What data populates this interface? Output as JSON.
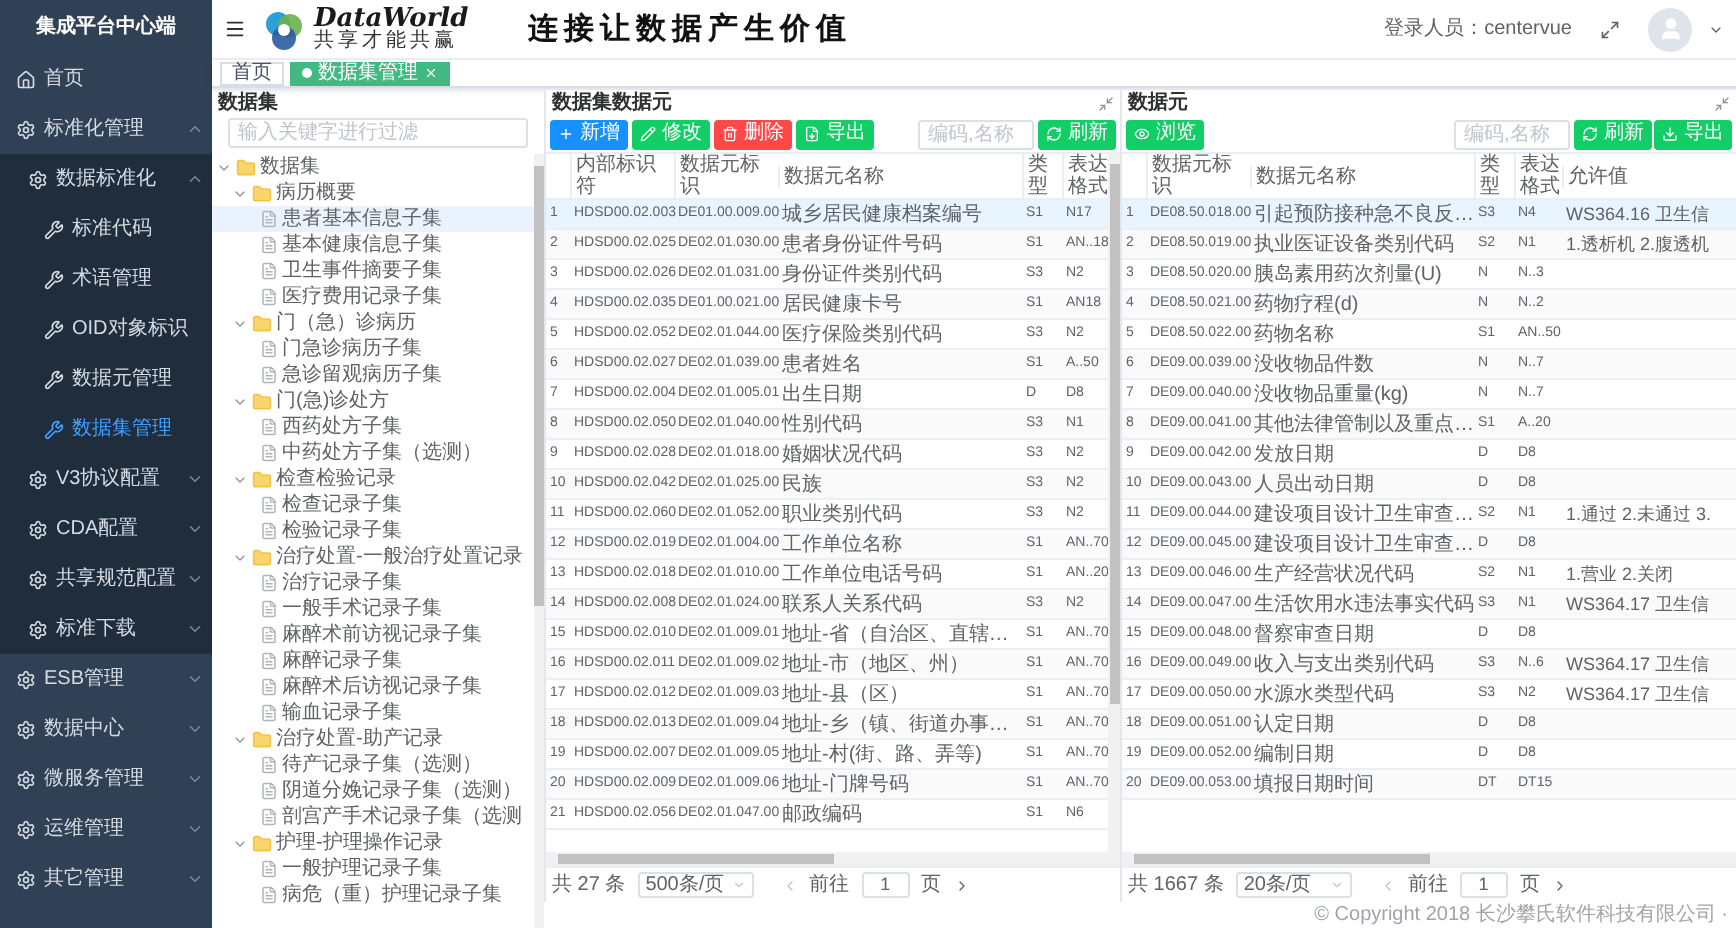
{
  "sidebar": {
    "title": "集成平台中心端",
    "items": [
      {
        "label": "首页",
        "kind": "home"
      },
      {
        "label": "标准化管理",
        "kind": "group",
        "expanded": true,
        "children": [
          {
            "label": "数据标准化",
            "kind": "group",
            "expanded": true,
            "children": [
              {
                "label": "标准代码",
                "kind": "page",
                "selected": false
              },
              {
                "label": "术语管理",
                "kind": "page",
                "selected": false
              },
              {
                "label": "OID对象标识",
                "kind": "page",
                "selected": false
              },
              {
                "label": "数据元管理",
                "kind": "page",
                "selected": false
              },
              {
                "label": "数据集管理",
                "kind": "page",
                "selected": true
              }
            ]
          },
          {
            "label": "V3协议配置",
            "kind": "group",
            "expanded": false
          },
          {
            "label": "CDA配置",
            "kind": "group",
            "expanded": false
          },
          {
            "label": "共享规范配置",
            "kind": "group",
            "expanded": false
          },
          {
            "label": "标准下载",
            "kind": "group",
            "expanded": false
          }
        ]
      },
      {
        "label": "ESB管理",
        "kind": "group",
        "expanded": false
      },
      {
        "label": "数据中心",
        "kind": "group",
        "expanded": false
      },
      {
        "label": "微服务管理",
        "kind": "group",
        "expanded": false
      },
      {
        "label": "运维管理",
        "kind": "group",
        "expanded": false
      },
      {
        "label": "其它管理",
        "kind": "group",
        "expanded": false
      }
    ]
  },
  "header": {
    "logo_name": "DataWorld",
    "logo_tagline": "共享才能共赢",
    "slogan": "连接让数据产生价值",
    "user_label": "登录人员：centervue"
  },
  "tabs": [
    {
      "label": "首页",
      "selected": false
    },
    {
      "label": "数据集管理",
      "selected": true
    }
  ],
  "tree_panel": {
    "title": "数据集",
    "placeholder": "输入关键字进行过滤",
    "nodes": [
      {
        "label": "数据集",
        "expanded": true,
        "children": [
          {
            "label": "病历概要",
            "expanded": true,
            "children": [
              {
                "label": "患者基本信息子集",
                "selected": true
              },
              {
                "label": "基本健康信息子集",
                "selected": false
              },
              {
                "label": "卫生事件摘要子集",
                "selected": false
              },
              {
                "label": "医疗费用记录子集",
                "selected": false
              }
            ]
          },
          {
            "label": "门（急）诊病历",
            "expanded": true,
            "children": [
              {
                "label": "门急诊病历子集",
                "selected": false
              },
              {
                "label": "急诊留观病历子集",
                "selected": false
              }
            ]
          },
          {
            "label": "门(急)诊处方",
            "expanded": true,
            "children": [
              {
                "label": "西药处方子集",
                "selected": false
              },
              {
                "label": "中药处方子集（选测）",
                "selected": false
              }
            ]
          },
          {
            "label": "检查检验记录",
            "expanded": true,
            "children": [
              {
                "label": "检查记录子集",
                "selected": false
              },
              {
                "label": "检验记录子集",
                "selected": false
              }
            ]
          },
          {
            "label": "治疗处置-一般治疗处置记录",
            "expanded": true,
            "children": [
              {
                "label": "治疗记录子集",
                "selected": false
              },
              {
                "label": "一般手术记录子集",
                "selected": false
              },
              {
                "label": "麻醉术前访视记录子集",
                "selected": false
              },
              {
                "label": "麻醉记录子集",
                "selected": false
              },
              {
                "label": "麻醉术后访视记录子集",
                "selected": false
              },
              {
                "label": "输血记录子集",
                "selected": false
              }
            ]
          },
          {
            "label": "治疗处置-助产记录",
            "expanded": true,
            "children": [
              {
                "label": "待产记录子集（选测）",
                "selected": false
              },
              {
                "label": "阴道分娩记录子集（选测）",
                "selected": false
              },
              {
                "label": "剖宫产手术记录子集（选测",
                "selected": false
              }
            ]
          },
          {
            "label": "护理-护理操作记录",
            "expanded": true,
            "children": [
              {
                "label": "一般护理记录子集",
                "selected": false
              },
              {
                "label": "病危（重）护理记录子集",
                "selected": false
              }
            ]
          }
        ]
      }
    ]
  },
  "middle_panel": {
    "title": "数据集数据元",
    "buttons": [
      {
        "label": "新增",
        "kind": "add"
      },
      {
        "label": "修改",
        "kind": "edit"
      },
      {
        "label": "删除",
        "kind": "delete"
      },
      {
        "label": "导出",
        "kind": "export"
      }
    ],
    "placeholder": "编码,名称",
    "right_buttons": [
      {
        "label": "刷新",
        "kind": "refresh"
      }
    ],
    "columns": [
      "",
      "内部标识符",
      "数据元标识",
      "数据元名称",
      "类型",
      "表达格式"
    ],
    "rows": [
      {
        "selected": true,
        "cells": [
          "1",
          "HDSD00.02.003",
          "DE01.00.009.00",
          "城乡居民健康档案编号",
          "S1",
          "N17"
        ]
      },
      {
        "selected": false,
        "cells": [
          "2",
          "HDSD00.02.025",
          "DE02.01.030.00",
          "患者身份证件号码",
          "S1",
          "AN..18"
        ]
      },
      {
        "selected": false,
        "cells": [
          "3",
          "HDSD00.02.026",
          "DE02.01.031.00",
          "身份证件类别代码",
          "S3",
          "N2"
        ]
      },
      {
        "selected": false,
        "cells": [
          "4",
          "HDSD00.02.035",
          "DE01.00.021.00",
          "居民健康卡号",
          "S1",
          "AN18"
        ]
      },
      {
        "selected": false,
        "cells": [
          "5",
          "HDSD00.02.052",
          "DE02.01.044.00",
          "医疗保险类别代码",
          "S3",
          "N2"
        ]
      },
      {
        "selected": false,
        "cells": [
          "6",
          "HDSD00.02.027",
          "DE02.01.039.00",
          "患者姓名",
          "S1",
          "A..50"
        ]
      },
      {
        "selected": false,
        "cells": [
          "7",
          "HDSD00.02.004",
          "DE02.01.005.01",
          "出生日期",
          "D",
          "D8"
        ]
      },
      {
        "selected": false,
        "cells": [
          "8",
          "HDSD00.02.050",
          "DE02.01.040.00",
          "性别代码",
          "S3",
          "N1"
        ]
      },
      {
        "selected": false,
        "cells": [
          "9",
          "HDSD00.02.028",
          "DE02.01.018.00",
          "婚姻状况代码",
          "S3",
          "N2"
        ]
      },
      {
        "selected": false,
        "cells": [
          "10",
          "HDSD00.02.042",
          "DE02.01.025.00",
          "民族",
          "S3",
          "N2"
        ]
      },
      {
        "selected": false,
        "cells": [
          "11",
          "HDSD00.02.060",
          "DE02.01.052.00",
          "职业类别代码",
          "S3",
          "N2"
        ]
      },
      {
        "selected": false,
        "cells": [
          "12",
          "HDSD00.02.019",
          "DE02.01.004.00",
          "工作单位名称",
          "S1",
          "AN..70"
        ]
      },
      {
        "selected": false,
        "cells": [
          "13",
          "HDSD00.02.018",
          "DE02.01.010.00",
          "工作单位电话号码",
          "S1",
          "AN..20"
        ]
      },
      {
        "selected": false,
        "cells": [
          "14",
          "HDSD00.02.008",
          "DE02.01.024.00",
          "联系人关系代码",
          "S3",
          "N2"
        ]
      },
      {
        "selected": false,
        "cells": [
          "15",
          "HDSD00.02.010",
          "DE02.01.009.01",
          "地址-省（自治区、直辖…",
          "S1",
          "AN..70"
        ]
      },
      {
        "selected": false,
        "cells": [
          "16",
          "HDSD00.02.011",
          "DE02.01.009.02",
          "地址-市（地区、州）",
          "S1",
          "AN..70"
        ]
      },
      {
        "selected": false,
        "cells": [
          "17",
          "HDSD00.02.012",
          "DE02.01.009.03",
          "地址-县（区）",
          "S1",
          "AN..70"
        ]
      },
      {
        "selected": false,
        "cells": [
          "18",
          "HDSD00.02.013",
          "DE02.01.009.04",
          "地址-乡（镇、街道办事…",
          "S1",
          "AN..70"
        ]
      },
      {
        "selected": false,
        "cells": [
          "19",
          "HDSD00.02.007",
          "DE02.01.009.05",
          "地址-村(街、路、弄等)",
          "S1",
          "AN..70"
        ]
      },
      {
        "selected": false,
        "cells": [
          "20",
          "HDSD00.02.009",
          "DE02.01.009.06",
          "地址-门牌号码",
          "S1",
          "AN..70"
        ]
      },
      {
        "selected": false,
        "cells": [
          "21",
          "HDSD00.02.056",
          "DE02.01.047.00",
          "邮政编码",
          "S1",
          "N6"
        ]
      }
    ],
    "footer": {
      "total": "共 27 条",
      "page_size": "500条/页",
      "goto": "前往",
      "page": "1",
      "page_unit": "页"
    }
  },
  "right_panel": {
    "title": "数据元",
    "buttons": [
      {
        "label": "浏览",
        "kind": "browse"
      }
    ],
    "placeholder": "编码,名称",
    "right_buttons": [
      {
        "label": "刷新",
        "kind": "refresh"
      },
      {
        "label": "导出",
        "kind": "download"
      }
    ],
    "columns": [
      "",
      "数据元标识",
      "数据元名称",
      "类型",
      "表达格式",
      "允许值"
    ],
    "rows": [
      {
        "selected": true,
        "cells": [
          "1",
          "DE08.50.018.00",
          "引起预防接种急不良反…",
          "S3",
          "N4",
          "WS364.16 卫生信"
        ]
      },
      {
        "selected": false,
        "cells": [
          "2",
          "DE08.50.019.00",
          "执业医证设备类别代码",
          "S2",
          "N1",
          "1.透析机 2.腹透机"
        ]
      },
      {
        "selected": false,
        "cells": [
          "3",
          "DE08.50.020.00",
          "胰岛素用药次剂量(U)",
          "N",
          "N..3",
          ""
        ]
      },
      {
        "selected": false,
        "cells": [
          "4",
          "DE08.50.021.00",
          "药物疗程(d)",
          "N",
          "N..2",
          ""
        ]
      },
      {
        "selected": false,
        "cells": [
          "5",
          "DE08.50.022.00",
          "药物名称",
          "S1",
          "AN..50",
          ""
        ]
      },
      {
        "selected": false,
        "cells": [
          "6",
          "DE09.00.039.00",
          "没收物品件数",
          "N",
          "N..7",
          ""
        ]
      },
      {
        "selected": false,
        "cells": [
          "7",
          "DE09.00.040.00",
          "没收物品重量(kg)",
          "N",
          "N..7",
          ""
        ]
      },
      {
        "selected": false,
        "cells": [
          "8",
          "DE09.00.041.00",
          "其他法律管制以及重点…",
          "S1",
          "A..20",
          ""
        ]
      },
      {
        "selected": false,
        "cells": [
          "9",
          "DE09.00.042.00",
          "发放日期",
          "D",
          "D8",
          ""
        ]
      },
      {
        "selected": false,
        "cells": [
          "10",
          "DE09.00.043.00",
          "人员出动日期",
          "D",
          "D8",
          ""
        ]
      },
      {
        "selected": false,
        "cells": [
          "11",
          "DE09.00.044.00",
          "建设项目设计卫生审查…",
          "S2",
          "N1",
          "1.通过 2.未通过 3."
        ]
      },
      {
        "selected": false,
        "cells": [
          "12",
          "DE09.00.045.00",
          "建设项目设计卫生审查…",
          "D",
          "D8",
          ""
        ]
      },
      {
        "selected": false,
        "cells": [
          "13",
          "DE09.00.046.00",
          "生产经营状况代码",
          "S2",
          "N1",
          "1.营业 2.关闭"
        ]
      },
      {
        "selected": false,
        "cells": [
          "14",
          "DE09.00.047.00",
          "生活饮用水违法事实代码",
          "S3",
          "N1",
          "WS364.17 卫生信"
        ]
      },
      {
        "selected": false,
        "cells": [
          "15",
          "DE09.00.048.00",
          "督察审查日期",
          "D",
          "D8",
          ""
        ]
      },
      {
        "selected": false,
        "cells": [
          "16",
          "DE09.00.049.00",
          "收入与支出类别代码",
          "S3",
          "N..6",
          "WS364.17 卫生信"
        ]
      },
      {
        "selected": false,
        "cells": [
          "17",
          "DE09.00.050.00",
          "水源水类型代码",
          "S3",
          "N2",
          "WS364.17 卫生信"
        ]
      },
      {
        "selected": false,
        "cells": [
          "18",
          "DE09.00.051.00",
          "认定日期",
          "D",
          "D8",
          ""
        ]
      },
      {
        "selected": false,
        "cells": [
          "19",
          "DE09.00.052.00",
          "编制日期",
          "D",
          "D8",
          ""
        ]
      },
      {
        "selected": false,
        "cells": [
          "20",
          "DE09.00.053.00",
          "填报日期时间",
          "DT",
          "DT15",
          ""
        ]
      }
    ],
    "footer": {
      "total": "共 1667 条",
      "page_size": "20条/页",
      "goto": "前往",
      "page": "1",
      "page_unit": "页"
    }
  },
  "copyright": "© Copyright 2018 长沙攀氏软件科技有限公司 ·"
}
